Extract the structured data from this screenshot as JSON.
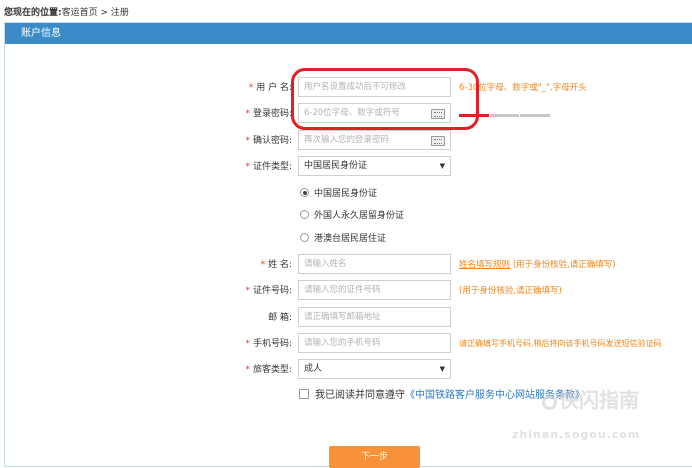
{
  "breadcrumb": {
    "prefix": "您现在的位置:",
    "home": "客运首页",
    "sep": " > ",
    "current": "注册"
  },
  "panel": {
    "title": "账户信息"
  },
  "form": {
    "username": {
      "label": "用 户 名:",
      "placeholder": "用户名设置成功后不可修改",
      "hint": "6-30位字母、数字或\"_\",字母开头"
    },
    "password": {
      "label": "登录密码:",
      "placeholder": "6-20位字母、数字或符号"
    },
    "confirm": {
      "label": "确认密码:",
      "placeholder": "再次输入您的登录密码"
    },
    "id_type": {
      "label": "证件类型:",
      "value": "中国居民身份证",
      "options": [
        "中国居民身份证",
        "外国人永久居留身份证",
        "港澳台居民居住证"
      ],
      "selected_index": 0
    },
    "name": {
      "label": "姓 名:",
      "placeholder": "请输入姓名",
      "hint_link": "姓名填写规则",
      "hint": "(用于身份核验,请正确填写)"
    },
    "id_number": {
      "label": "证件号码:",
      "placeholder": "请输入您的证件号码",
      "hint": "(用于身份核验,请正确填写)"
    },
    "email": {
      "label": "邮 箱:",
      "placeholder": "请正确填写邮箱地址"
    },
    "phone": {
      "label": "手机号码:",
      "placeholder": "请输入您的手机号码",
      "hint": "请正确填写手机号码,稍后将向该手机号码发送短信验证码"
    },
    "passenger_type": {
      "label": "旅客类型:",
      "value": "成人"
    },
    "agreement": {
      "prefix": "我已阅读并同意遵守",
      "link": "《中国铁路客户服务中心网站服务条款》"
    },
    "submit_label": "下一步"
  },
  "required_mark": "*",
  "watermark": {
    "text": "快闪指南",
    "url": "zhinan.sogou.com"
  },
  "colors": {
    "header_bg": "#3c8bc9",
    "required": "#e53a2f",
    "hint": "#f0851a",
    "submit_bg": "#f7923a",
    "highlight": "#e01f26",
    "link": "#2d78c5"
  },
  "icons": {
    "keyboard": "keyboard-icon",
    "select_arrow": "triangle-down-icon"
  }
}
